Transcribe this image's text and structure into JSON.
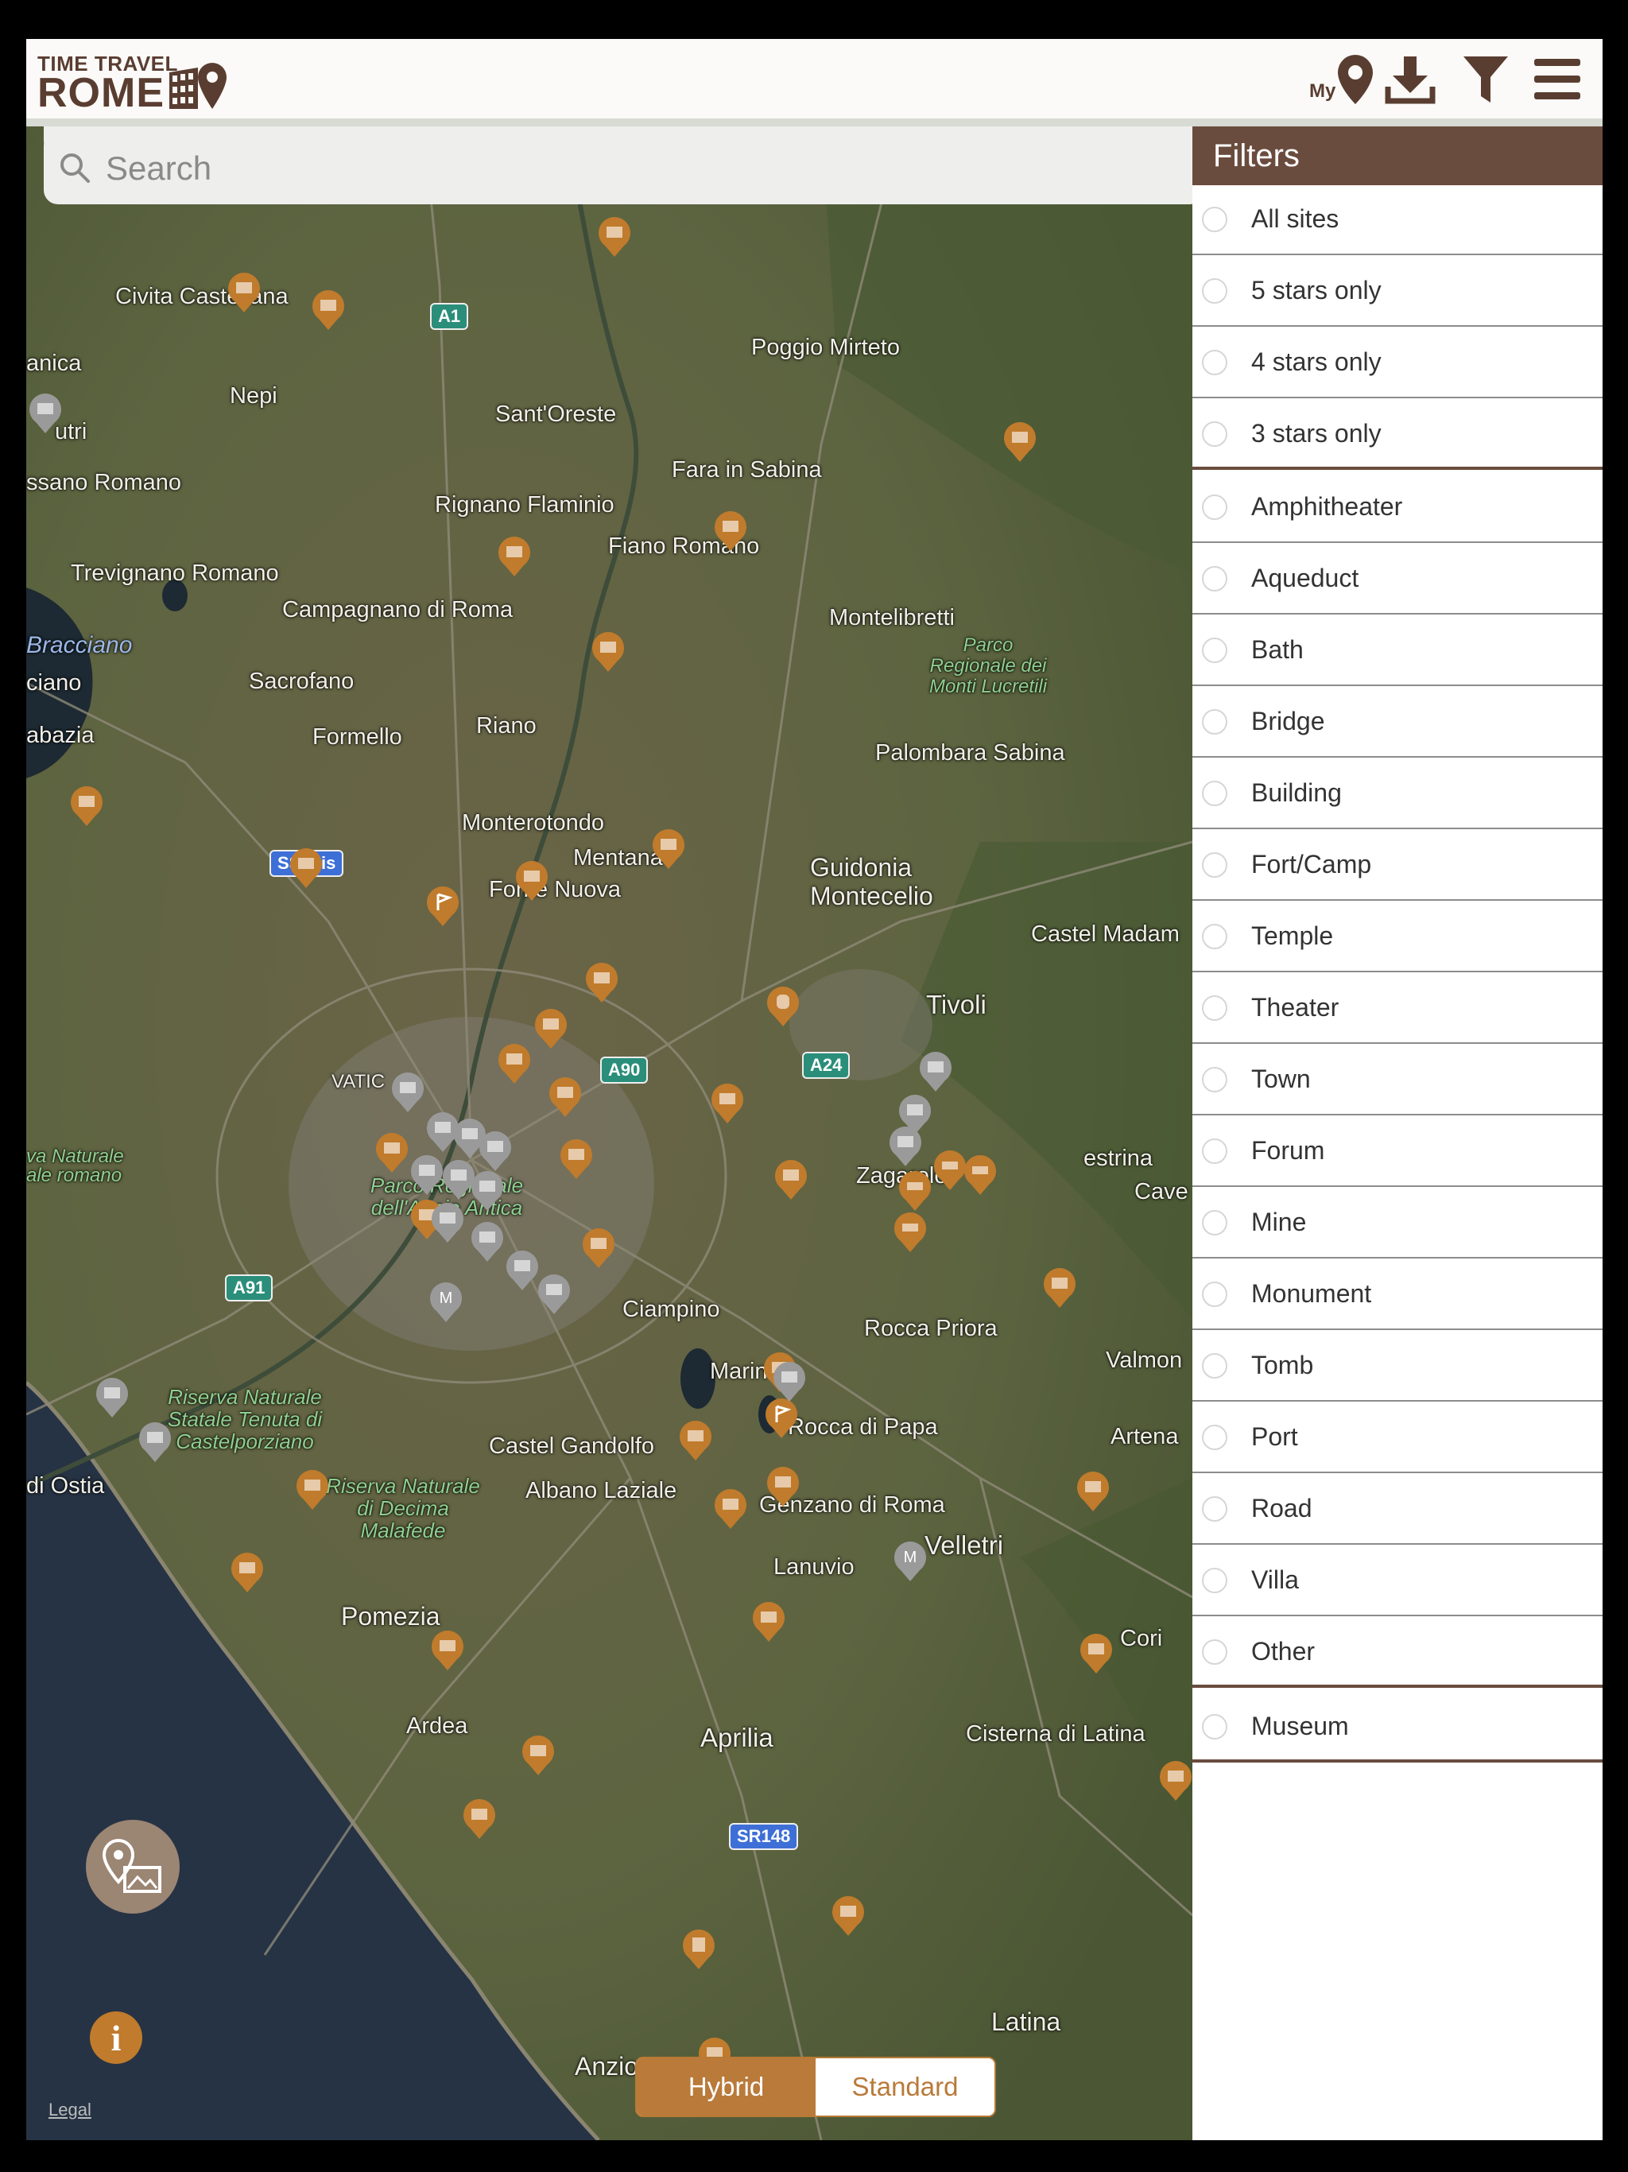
{
  "header": {
    "logo_top": "TIME TRAVEL",
    "logo_main": "ROME",
    "my_location_label": "My"
  },
  "search": {
    "placeholder": "Search"
  },
  "map": {
    "places": [
      {
        "label": "Civita Castellana",
        "kind": "town"
      },
      {
        "label": "Nepi",
        "kind": "town"
      },
      {
        "label": "anica",
        "kind": "town"
      },
      {
        "label": "utri",
        "kind": "town"
      },
      {
        "label": "ssano Romano",
        "kind": "town"
      },
      {
        "label": "Sant'Oreste",
        "kind": "town"
      },
      {
        "label": "Poggio Mirteto",
        "kind": "town"
      },
      {
        "label": "Fara in Sabina",
        "kind": "town"
      },
      {
        "label": "Rignano Flaminio",
        "kind": "town"
      },
      {
        "label": "Trevignano Romano",
        "kind": "town"
      },
      {
        "label": "Fiano Romano",
        "kind": "town"
      },
      {
        "label": "Campagnano di Roma",
        "kind": "town"
      },
      {
        "label": "Montelibretti",
        "kind": "town"
      },
      {
        "label": "Bracciano",
        "kind": "water"
      },
      {
        "label": "ciano",
        "kind": "town"
      },
      {
        "label": "Sacrofano",
        "kind": "town"
      },
      {
        "label": "Parco Regionale dei Monti Lucretili",
        "kind": "park"
      },
      {
        "label": "abazia",
        "kind": "town"
      },
      {
        "label": "Formello",
        "kind": "town"
      },
      {
        "label": "Riano",
        "kind": "town"
      },
      {
        "label": "Palombara Sabina",
        "kind": "town"
      },
      {
        "label": "Monterotondo",
        "kind": "town"
      },
      {
        "label": "Mentana",
        "kind": "town"
      },
      {
        "label": "Guidonia Montecelio",
        "kind": "town"
      },
      {
        "label": "Fonte Nuova",
        "kind": "town"
      },
      {
        "label": "Castel Madam",
        "kind": "town"
      },
      {
        "label": "Tivoli",
        "kind": "town"
      },
      {
        "label": "VATIC",
        "kind": "town"
      },
      {
        "label": "estrina",
        "kind": "town"
      },
      {
        "label": "Cave",
        "kind": "town"
      },
      {
        "label": "Zagarolo",
        "kind": "town"
      },
      {
        "label": "va Naturale ale romano",
        "kind": "park"
      },
      {
        "label": "Parco Regionale dell'Appia Antica",
        "kind": "park"
      },
      {
        "label": "Ciampino",
        "kind": "town"
      },
      {
        "label": "Rocca Priora",
        "kind": "town"
      },
      {
        "label": "Valmon",
        "kind": "town"
      },
      {
        "label": "Marino",
        "kind": "town"
      },
      {
        "label": "Riserva Naturale Statale Tenuta di Castelporziano",
        "kind": "park"
      },
      {
        "label": "Rocca di Papa",
        "kind": "town"
      },
      {
        "label": "Artena",
        "kind": "town"
      },
      {
        "label": "Castel Gandolfo",
        "kind": "town"
      },
      {
        "label": "di Ostia",
        "kind": "town"
      },
      {
        "label": "Albano Laziale",
        "kind": "town"
      },
      {
        "label": "Genzano di Roma",
        "kind": "town"
      },
      {
        "label": "Riserva Naturale di Decima Malafede",
        "kind": "park"
      },
      {
        "label": "Velletri",
        "kind": "town"
      },
      {
        "label": "Lanuvio",
        "kind": "town"
      },
      {
        "label": "Pomezia",
        "kind": "town"
      },
      {
        "label": "Cori",
        "kind": "town"
      },
      {
        "label": "Ardea",
        "kind": "town"
      },
      {
        "label": "Aprilia",
        "kind": "town"
      },
      {
        "label": "Cisterna di Latina",
        "kind": "town"
      },
      {
        "label": "Latina",
        "kind": "town"
      },
      {
        "label": "Anzio",
        "kind": "town"
      }
    ],
    "roads": [
      "A1",
      "SS2bis",
      "A90",
      "A24",
      "A91",
      "SR148"
    ],
    "legal": "Legal",
    "map_type": {
      "hybrid": "Hybrid",
      "standard": "Standard",
      "selected": "Hybrid"
    }
  },
  "filters": {
    "title": "Filters",
    "items": [
      {
        "label": "All sites"
      },
      {
        "label": "5 stars only"
      },
      {
        "label": "4 stars only"
      },
      {
        "label": "3 stars only"
      },
      {
        "label": "Amphitheater"
      },
      {
        "label": "Aqueduct"
      },
      {
        "label": "Bath"
      },
      {
        "label": "Bridge"
      },
      {
        "label": "Building"
      },
      {
        "label": "Fort/Camp"
      },
      {
        "label": "Temple"
      },
      {
        "label": "Theater"
      },
      {
        "label": "Town"
      },
      {
        "label": "Forum"
      },
      {
        "label": "Mine"
      },
      {
        "label": "Monument"
      },
      {
        "label": "Tomb"
      },
      {
        "label": "Port"
      },
      {
        "label": "Road"
      },
      {
        "label": "Villa"
      },
      {
        "label": "Other"
      },
      {
        "label": "Museum"
      }
    ]
  },
  "colors": {
    "brand_brown": "#5a3d31",
    "panel_header": "#6a4c3e",
    "accent_orange": "#c07b2c",
    "pin_grey": "#9a9a9a"
  }
}
